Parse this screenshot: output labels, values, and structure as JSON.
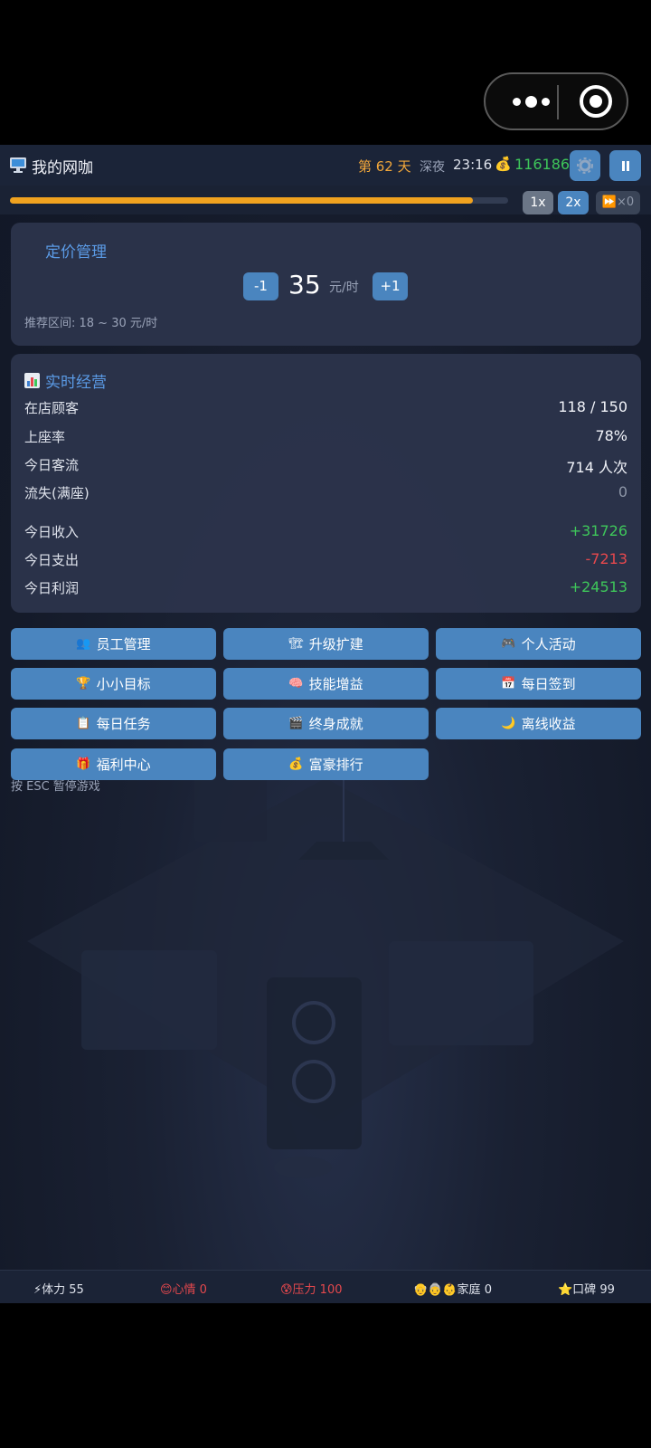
{
  "header": {
    "title": "我的网咖",
    "day": "第 62 天",
    "phase": "深夜",
    "time": "23:16",
    "money": "116186"
  },
  "progress": {
    "fraction": 0.93
  },
  "speed": {
    "x1": "1x",
    "x2": "2x",
    "skip": "×0"
  },
  "pricing": {
    "title": "定价管理",
    "minus": "-1",
    "value": "35",
    "unit": "元/时",
    "plus": "+1",
    "recommend": "推荐区间: 18 ~ 30 元/时"
  },
  "ops": {
    "title": "实时经营",
    "rows": [
      {
        "label": "在店顾客",
        "value": "118 / 150"
      },
      {
        "label": "上座率",
        "value": "78%"
      },
      {
        "label": "今日客流",
        "value": "714 人次"
      },
      {
        "label": "流失(满座)",
        "value": "0"
      },
      {
        "label": "今日收入",
        "value": "+31726"
      },
      {
        "label": "今日支出",
        "value": "-7213"
      },
      {
        "label": "今日利润",
        "value": "+24513"
      }
    ]
  },
  "menu": [
    {
      "emoji": "👥",
      "label": "员工管理"
    },
    {
      "emoji": "🏗",
      "label": "升级扩建"
    },
    {
      "emoji": "🎮",
      "label": "个人活动"
    },
    {
      "emoji": "🏆",
      "label": "小小目标"
    },
    {
      "emoji": "🧠",
      "label": "技能增益"
    },
    {
      "emoji": "📅",
      "label": "每日签到"
    },
    {
      "emoji": "📋",
      "label": "每日任务"
    },
    {
      "emoji": "🎬",
      "label": "终身成就"
    },
    {
      "emoji": "🌙",
      "label": "离线收益"
    },
    {
      "emoji": "🎁",
      "label": "福利中心"
    },
    {
      "emoji": "💰",
      "label": "富豪排行"
    }
  ],
  "hint": "按 ESC 暂停游戏",
  "status": {
    "stamina": "⚡体力 55",
    "mood": "😊心情 0",
    "stress": "😰压力 100",
    "family": "👴👵👶家庭 0",
    "reputation": "⭐口碑 99"
  },
  "colors": {
    "accent": "#4a85bf",
    "title_blue": "#5b9be6",
    "gold": "#f2a73a",
    "money_green": "#3ec65a",
    "expense_red": "#e5484d",
    "progress": "#f0a21f"
  }
}
